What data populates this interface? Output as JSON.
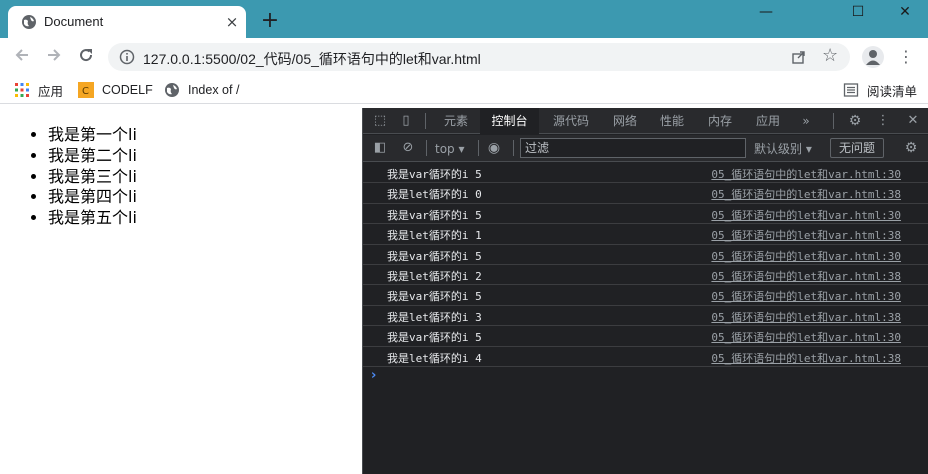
{
  "browser": {
    "tab_title": "Document",
    "tab_close": "×",
    "new_tab": "+",
    "window_minimize": "—",
    "window_maximize": "☐",
    "window_close": "✕",
    "url": "127.0.0.1:5500/02_代码/05_循环语句中的let和var.html",
    "bookmarks": [
      {
        "label": "应用"
      },
      {
        "label": "CODELF"
      },
      {
        "label": "Index of /"
      }
    ],
    "reading_list": "阅读清单"
  },
  "page": {
    "items": [
      "我是第一个li",
      "我是第二个li",
      "我是第三个li",
      "我是第四个li",
      "我是第五个li"
    ]
  },
  "devtools": {
    "tabs": [
      "元素",
      "控制台",
      "源代码",
      "网络",
      "性能",
      "内存",
      "应用"
    ],
    "active_tab": "控制台",
    "more_tabs": "»",
    "context": "top ▾",
    "filter_placeholder": "过滤",
    "levels": "默认级别 ▾",
    "issues": "无问题",
    "logs": [
      {
        "msg": "我是var循环的i 5",
        "src": "05_循环语句中的let和var.html:30"
      },
      {
        "msg": "我是let循环的i 0",
        "src": "05_循环语句中的let和var.html:38"
      },
      {
        "msg": "我是var循环的i 5",
        "src": "05_循环语句中的let和var.html:30"
      },
      {
        "msg": "我是let循环的i 1",
        "src": "05_循环语句中的let和var.html:38"
      },
      {
        "msg": "我是var循环的i 5",
        "src": "05_循环语句中的let和var.html:30"
      },
      {
        "msg": "我是let循环的i 2",
        "src": "05_循环语句中的let和var.html:38"
      },
      {
        "msg": "我是var循环的i 5",
        "src": "05_循环语句中的let和var.html:30"
      },
      {
        "msg": "我是let循环的i 3",
        "src": "05_循环语句中的let和var.html:38"
      },
      {
        "msg": "我是var循环的i 5",
        "src": "05_循环语句中的let和var.html:30"
      },
      {
        "msg": "我是let循环的i 4",
        "src": "05_循环语句中的let和var.html:38"
      }
    ],
    "prompt": "›"
  }
}
